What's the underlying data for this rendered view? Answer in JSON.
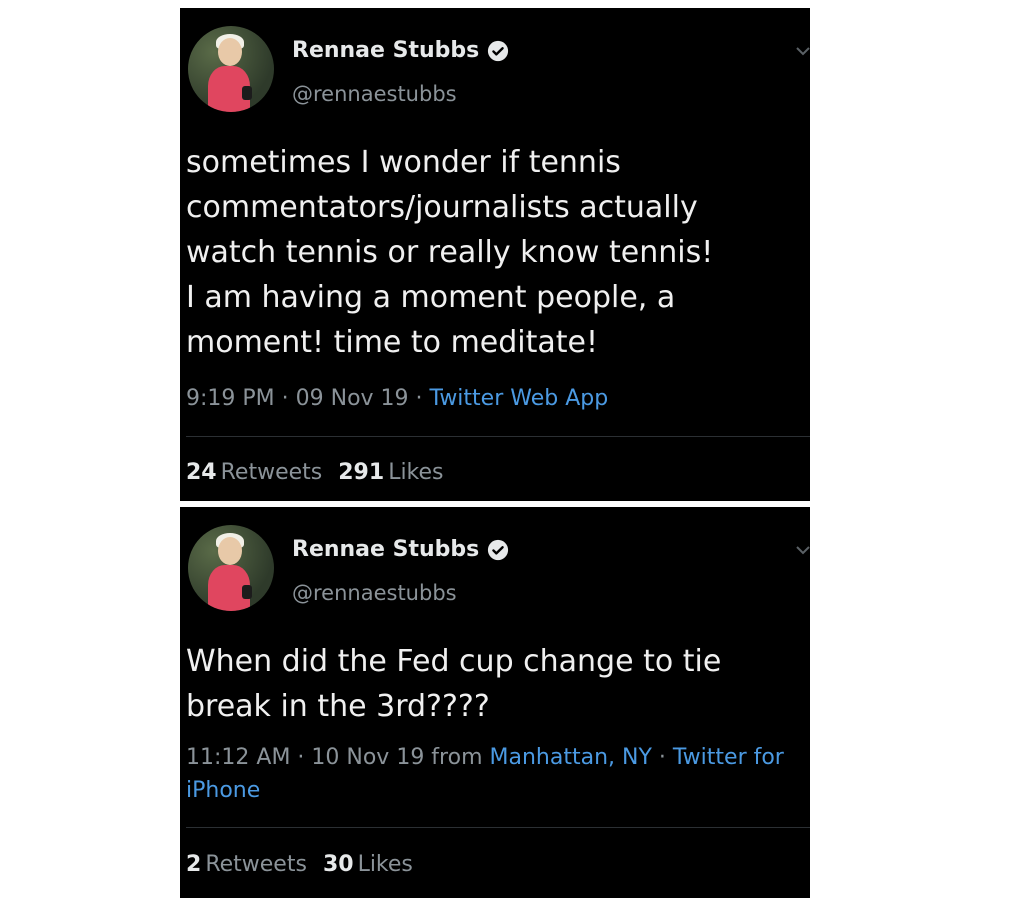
{
  "tweets": [
    {
      "name": "Rennae Stubbs",
      "handle": "@rennaestubbs",
      "text": "sometimes I wonder if tennis\ncommentators/journalists actually\nwatch tennis or really know tennis!\nI am having a moment people, a\nmoment! time to meditate!",
      "time": "9:19 PM · 09 Nov 19 · ",
      "source": "Twitter Web App",
      "retweets_count": "24",
      "retweets_label": "Retweets",
      "likes_count": "291",
      "likes_label": "Likes"
    },
    {
      "name": "Rennae Stubbs",
      "handle": "@rennaestubbs",
      "text": "When did the Fed cup change to tie\nbreak in the 3rd????",
      "time": "11:12 AM · 10 Nov 19 from ",
      "location": "Manhattan, NY",
      "separator": " · ",
      "source": "Twitter for iPhone",
      "retweets_count": "2",
      "retweets_label": "Retweets",
      "likes_count": "30",
      "likes_label": "Likes"
    }
  ],
  "icons": {
    "verified": "verified-badge-icon",
    "chevron": "chevron-down-icon"
  },
  "colors": {
    "background": "#000000",
    "link": "#4b9ae3",
    "muted": "#8b9399"
  }
}
